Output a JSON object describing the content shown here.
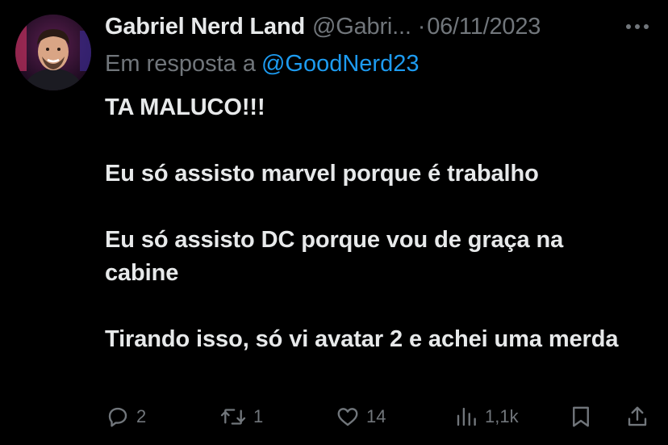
{
  "tweet": {
    "author_name": "Gabriel Nerd Land",
    "author_handle": "@Gabri...",
    "separator": "·",
    "date": "06/11/2023",
    "reply_prefix": "Em resposta a",
    "reply_handle": "@GoodNerd23",
    "paragraphs": [
      "TA MALUCO!!!",
      "Eu só assisto marvel porque é trabalho",
      "Eu só assisto DC porque vou de graça na cabine",
      "Tirando isso, só vi avatar 2 e achei uma merda"
    ]
  },
  "actions": {
    "replies": "2",
    "retweets": "1",
    "likes": "14",
    "views": "1,1k"
  },
  "icons": {
    "more": "more-horizontal-icon",
    "reply": "reply-bubble-icon",
    "retweet": "retweet-icon",
    "like": "heart-icon",
    "views": "analytics-bars-icon",
    "bookmark": "bookmark-icon",
    "share": "share-upload-icon"
  },
  "colors": {
    "background": "#000000",
    "text": "#e7e9ea",
    "secondary": "#71767b",
    "link": "#1d9bf0"
  }
}
